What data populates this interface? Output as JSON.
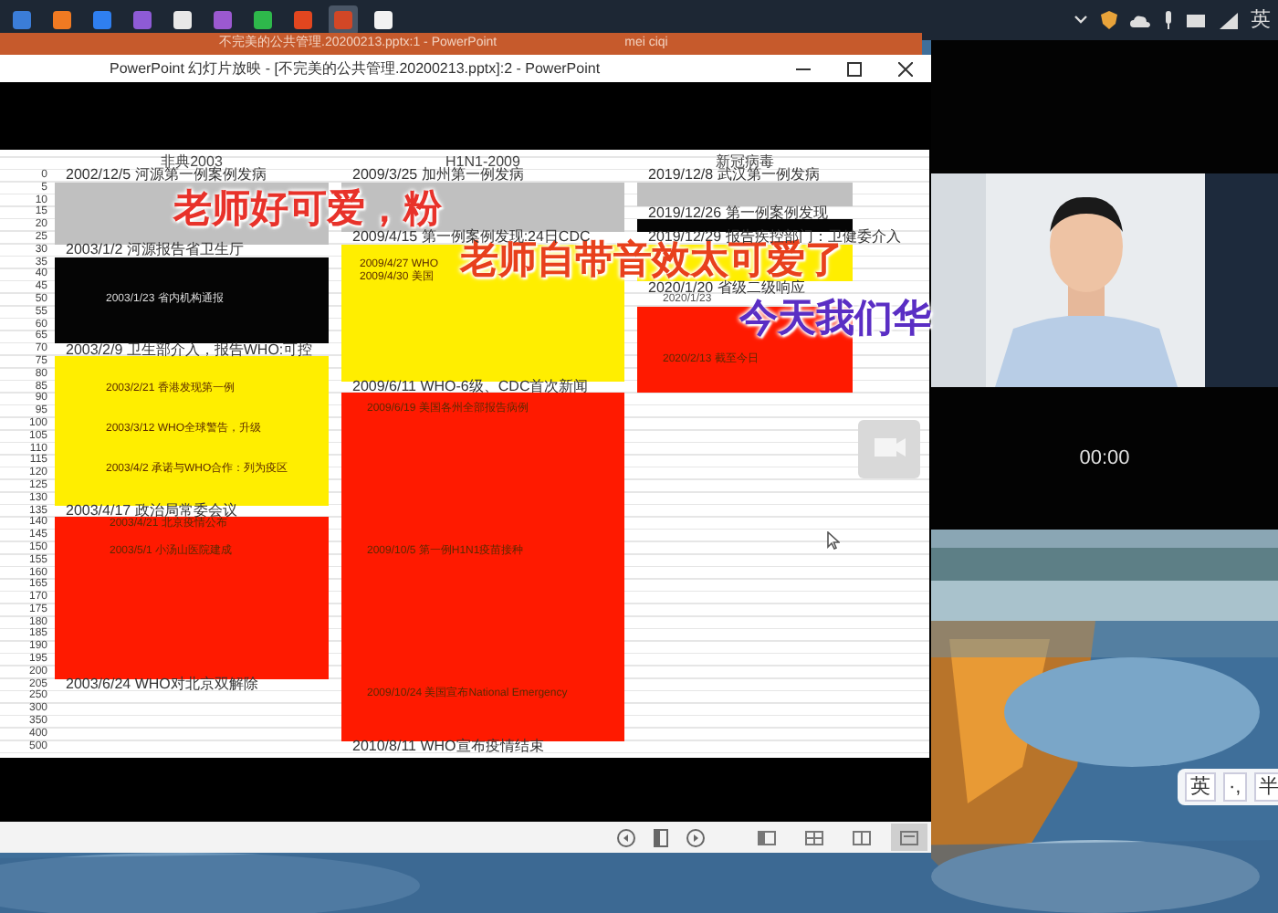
{
  "taskbar": {
    "apps": [
      {
        "selected": false
      },
      {
        "selected": false
      },
      {
        "selected": false
      },
      {
        "selected": false
      },
      {
        "selected": false
      },
      {
        "selected": false
      },
      {
        "selected": false
      },
      {
        "selected": false
      },
      {
        "selected": true
      },
      {
        "selected": false
      }
    ],
    "input_mode": "英"
  },
  "back_window": {
    "title": "不完美的公共管理.20200213.pptx:1  -  PowerPoint",
    "user": "mei ciqi"
  },
  "slideshow_window": {
    "title": "PowerPoint 幻灯片放映 - [不完美的公共管理.20200213.pptx]:2 - PowerPoint",
    "slide": {
      "axis": [
        "0",
        "5",
        "10",
        "15",
        "20",
        "25",
        "30",
        "35",
        "40",
        "45",
        "50",
        "55",
        "60",
        "65",
        "70",
        "75",
        "80",
        "85",
        "90",
        "95",
        "100",
        "105",
        "110",
        "115",
        "120",
        "125",
        "130",
        "135",
        "140",
        "145",
        "150",
        "155",
        "160",
        "165",
        "170",
        "175",
        "180",
        "185",
        "190",
        "195",
        "200",
        "205",
        "250",
        "300",
        "350",
        "400",
        "500"
      ],
      "columns": [
        {
          "title": "非典2003",
          "segments": [
            {
              "kind": "line",
              "text": "2002/12/5 河源第一例案例发病"
            },
            {
              "kind": "block",
              "color": "#c0c0c0"
            },
            {
              "kind": "line",
              "text": "2003/1/2 河源报告省卫生厅"
            },
            {
              "kind": "block",
              "color": "#050505",
              "items": [
                "2003/1/23 省内机构通报"
              ]
            },
            {
              "kind": "line",
              "text": "2003/2/9 卫生部介入，报告WHO:可控"
            },
            {
              "kind": "block",
              "color": "#ffee00",
              "items": [
                "2003/2/21 香港发现第一例",
                "2003/3/12 WHO全球警告，升级",
                "2003/4/2 承诺与WHO合作：列为疫区"
              ]
            },
            {
              "kind": "line",
              "text": "2003/4/17 政治局常委会议"
            },
            {
              "kind": "block",
              "color": "#ff1a00",
              "items": [
                "2003/4/21 北京疫情公布",
                "2003/5/1 小汤山医院建成"
              ]
            },
            {
              "kind": "line",
              "text": "2003/6/24 WHO对北京双解除"
            }
          ]
        },
        {
          "title": "H1N1-2009",
          "segments": [
            {
              "kind": "line",
              "text": "2009/3/25 加州第一例发病"
            },
            {
              "kind": "block",
              "color": "#c0c0c0"
            },
            {
              "kind": "line",
              "text": "2009/4/15 第一例案例发现:24日CDC"
            },
            {
              "kind": "block",
              "color": "#ffee00",
              "items": [
                "2009/4/27 WHO",
                "2009/4/30 美国"
              ]
            },
            {
              "kind": "line",
              "text": "2009/6/11 WHO-6级、CDC首次新闻"
            },
            {
              "kind": "block",
              "color": "#ff1a00",
              "items": [
                "2009/6/19 美国各州全部报告病例",
                "2009/10/5 第一例H1N1疫苗接种",
                "2009/10/24 美国宣布National Emergency"
              ]
            },
            {
              "kind": "line",
              "text": "2010/8/11 WHO宣布疫情结束"
            }
          ]
        },
        {
          "title": "新冠病毒",
          "segments": [
            {
              "kind": "line",
              "text": "2019/12/8 武汉第一例发病"
            },
            {
              "kind": "block",
              "color": "#c0c0c0"
            },
            {
              "kind": "line",
              "text": "2019/12/26 第一例案例发现"
            },
            {
              "kind": "block",
              "color": "#050505"
            },
            {
              "kind": "line",
              "text": "2019/12/29 报告疾控部门：卫健委介入"
            },
            {
              "kind": "block",
              "color": "#ffee00"
            },
            {
              "kind": "line",
              "text": "2020/1/20 省级二级响应"
            },
            {
              "kind": "note",
              "text": "2020/1/23"
            },
            {
              "kind": "block",
              "color": "#ff1a00",
              "items": [
                "2020/2/13 截至今日"
              ]
            }
          ]
        }
      ]
    },
    "views": [
      {
        "selected": false
      },
      {
        "selected": false
      },
      {
        "selected": false
      },
      {
        "selected": true
      }
    ]
  },
  "comments": [
    {
      "text": "老师好可爱，粉",
      "color": "#e8322a"
    },
    {
      "text": "老师自带音效太可爱了",
      "color": "#e8401c"
    },
    {
      "text": "今天我们华",
      "color": "#5a2ec4"
    }
  ],
  "video_panel": {
    "timer": "00:00"
  },
  "ime_bar": [
    "英",
    "·,",
    "半"
  ]
}
